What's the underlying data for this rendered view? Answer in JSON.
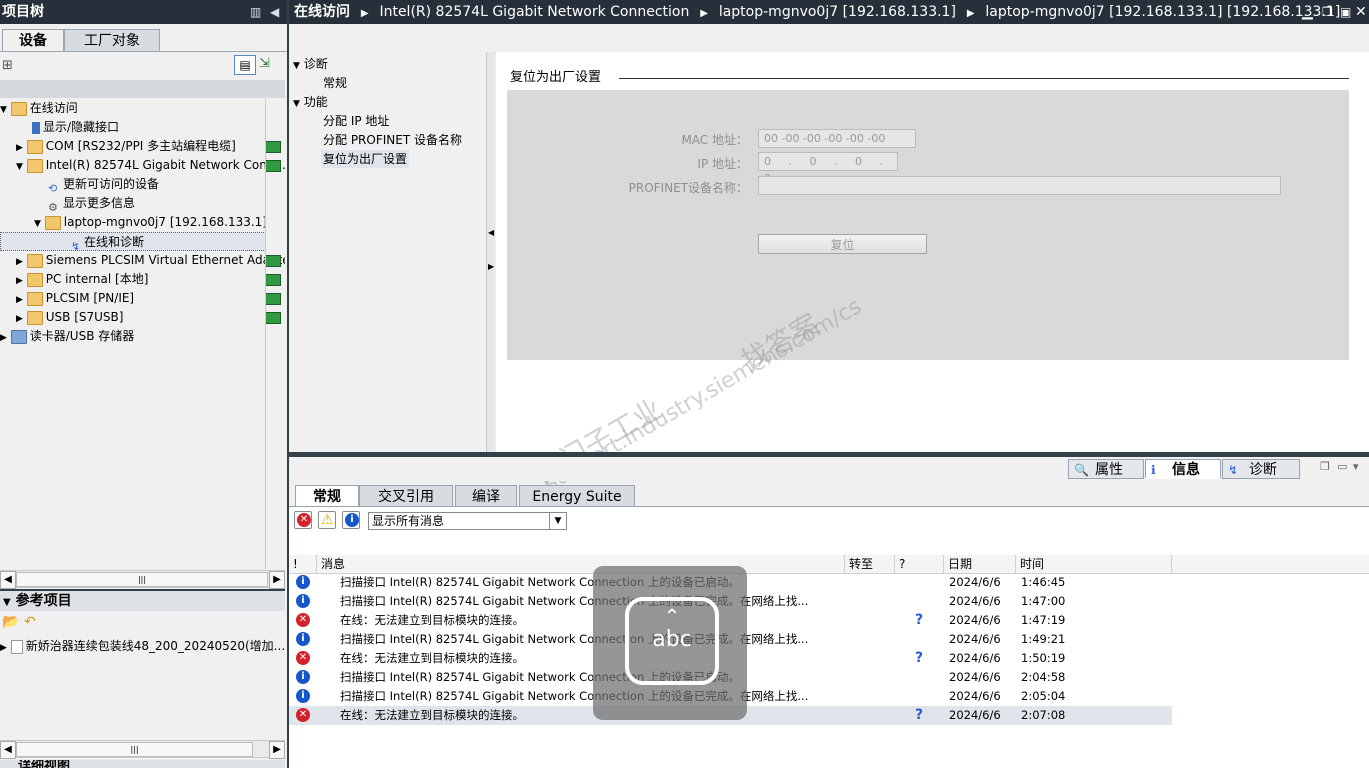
{
  "left_panel": {
    "title": "项目树",
    "tabs": [
      "设备",
      "工厂对象"
    ],
    "tree": [
      {
        "label": "在线访问",
        "level": 0,
        "expanded": true
      },
      {
        "label": "显示/隐藏接口",
        "level": 2
      },
      {
        "label": "COM [RS232/PPI 多主站编程电缆]",
        "level": 1
      },
      {
        "label": "Intel(R) 82574L Gigabit Network Conn...",
        "level": 1,
        "expanded": true
      },
      {
        "label": "更新可访问的设备",
        "level": 2
      },
      {
        "label": "显示更多信息",
        "level": 2
      },
      {
        "label": "laptop-mgnvo0j7 [192.168.133.1]",
        "level": 2,
        "expanded": true
      },
      {
        "label": "在线和诊断",
        "level": 3,
        "selected": true
      },
      {
        "label": "Siemens PLCSIM Virtual Ethernet Adapter",
        "level": 1
      },
      {
        "label": "PC internal [本地]",
        "level": 1
      },
      {
        "label": "PLCSIM [PN/IE]",
        "level": 1
      },
      {
        "label": "USB [S7USB]",
        "level": 1
      },
      {
        "label": "读卡器/USB 存储器",
        "level": 0
      }
    ],
    "ref_title": "参考项目",
    "ref_item": "新娇治器连续包装线48_200_20240520(增加...",
    "bottom_title": "详细视图"
  },
  "main": {
    "breadcrumb": [
      "在线访问",
      "Intel(R) 82574L Gigabit Network Connection",
      "laptop-mgnvo0j7 [192.168.133.1]",
      "laptop-mgnvo0j7 [192.168.133.1] [192.168.133.1]"
    ],
    "menu": {
      "diagnostics": "诊断",
      "general": "常规",
      "functions": "功能",
      "assign_ip": "分配 IP 地址",
      "assign_name": "分配 PROFINET 设备名称",
      "reset": "复位为出厂设置"
    },
    "section_title": "复位为出厂设置",
    "mac_label": "MAC 地址：",
    "mac_value": "00 -00 -00 -00 -00 -00",
    "ip_label": "IP 地址：",
    "ip_value": "0 . 0 . 0 . 0",
    "name_label": "PROFINET设备名称：",
    "name_value": "",
    "reset_button": "复位"
  },
  "watermark": {
    "line1": "西门子工业",
    "line2": "找答案",
    "line3": "support.industry.siemens.com/cs"
  },
  "inspector": {
    "tabs": [
      "属性",
      "信息",
      "诊断"
    ],
    "subtabs": [
      "常规",
      "交叉引用",
      "编译",
      "Energy Suite"
    ],
    "filter": "显示所有消息",
    "columns": [
      "!",
      "消息",
      "转至",
      "?",
      "日期",
      "时间"
    ],
    "messages": [
      {
        "type": "info",
        "text": "扫描接口 Intel(R) 82574L Gigabit Network Connection 上的设备已启动。",
        "help": false,
        "date": "2024/6/6",
        "time": "1:46:45"
      },
      {
        "type": "info",
        "text": "扫描接口 Intel(R) 82574L Gigabit Network Connection 上的设备已完成。在网络上找...",
        "help": false,
        "date": "2024/6/6",
        "time": "1:47:00"
      },
      {
        "type": "error",
        "text": "在线：无法建立到目标模块的连接。",
        "help": true,
        "date": "2024/6/6",
        "time": "1:47:19"
      },
      {
        "type": "info",
        "text": "扫描接口 Intel(R) 82574L Gigabit Network Connection 上的设备已完成。在网络上找...",
        "help": false,
        "date": "2024/6/6",
        "time": "1:49:21"
      },
      {
        "type": "error",
        "text": "在线：无法建立到目标模块的连接。",
        "help": true,
        "date": "2024/6/6",
        "time": "1:50:19"
      },
      {
        "type": "info",
        "text": "扫描接口 Intel(R) 82574L Gigabit Network Connection 上的设备已启动。",
        "help": false,
        "date": "2024/6/6",
        "time": "2:04:58"
      },
      {
        "type": "info",
        "text": "扫描接口 Intel(R) 82574L Gigabit Network Connection 上的设备已完成。在网络上找...",
        "help": false,
        "date": "2024/6/6",
        "time": "2:05:04"
      },
      {
        "type": "error",
        "text": "在线：无法建立到目标模块的连接。",
        "help": true,
        "date": "2024/6/6",
        "time": "2:07:08"
      }
    ]
  },
  "overlay": {
    "label": "abc"
  }
}
